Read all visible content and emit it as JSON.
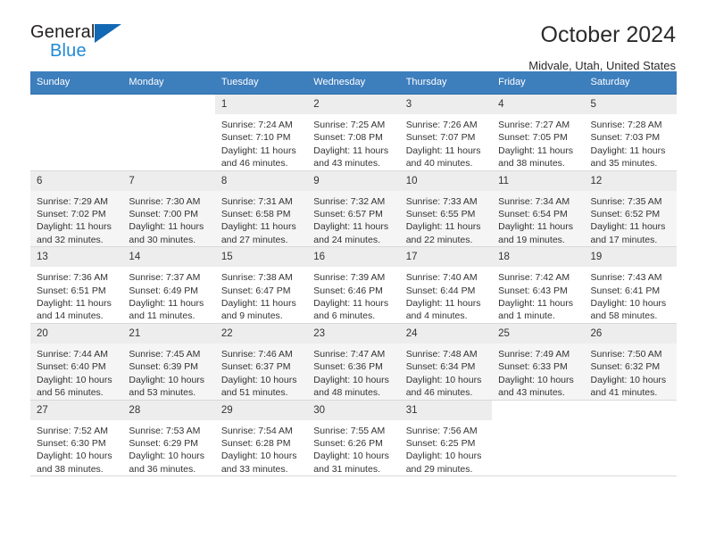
{
  "brand": {
    "name_top": "General",
    "name_bottom": "Blue",
    "triangle_icon": "triangle-icon",
    "color_top": "#231f20",
    "color_bottom": "#1e8ad6",
    "triangle_color": "#1268b3"
  },
  "header": {
    "title": "October 2024",
    "subtitle": "Midvale, Utah, United States"
  },
  "theme": {
    "header_row_bg": "#3d7ebd",
    "header_row_text": "#ffffff",
    "daynum_bg": "#ededed",
    "alt_row_bg": "#f5f5f5",
    "grid_line": "#2f6da8",
    "body_text": "#333333"
  },
  "weekday_headers": [
    "Sunday",
    "Monday",
    "Tuesday",
    "Wednesday",
    "Thursday",
    "Friday",
    "Saturday"
  ],
  "labels": {
    "sunrise_prefix": "Sunrise:",
    "sunset_prefix": "Sunset:",
    "daylight_prefix": "Daylight:"
  },
  "weeks": [
    {
      "alt": false,
      "days": [
        {
          "empty": true,
          "day": "",
          "sunrise": "",
          "sunset": "",
          "daylight_line1": "",
          "daylight_line2": ""
        },
        {
          "empty": true,
          "day": "",
          "sunrise": "",
          "sunset": "",
          "daylight_line1": "",
          "daylight_line2": ""
        },
        {
          "empty": false,
          "day": "1",
          "sunrise": "Sunrise: 7:24 AM",
          "sunset": "Sunset: 7:10 PM",
          "daylight_line1": "Daylight: 11 hours",
          "daylight_line2": "and 46 minutes."
        },
        {
          "empty": false,
          "day": "2",
          "sunrise": "Sunrise: 7:25 AM",
          "sunset": "Sunset: 7:08 PM",
          "daylight_line1": "Daylight: 11 hours",
          "daylight_line2": "and 43 minutes."
        },
        {
          "empty": false,
          "day": "3",
          "sunrise": "Sunrise: 7:26 AM",
          "sunset": "Sunset: 7:07 PM",
          "daylight_line1": "Daylight: 11 hours",
          "daylight_line2": "and 40 minutes."
        },
        {
          "empty": false,
          "day": "4",
          "sunrise": "Sunrise: 7:27 AM",
          "sunset": "Sunset: 7:05 PM",
          "daylight_line1": "Daylight: 11 hours",
          "daylight_line2": "and 38 minutes."
        },
        {
          "empty": false,
          "day": "5",
          "sunrise": "Sunrise: 7:28 AM",
          "sunset": "Sunset: 7:03 PM",
          "daylight_line1": "Daylight: 11 hours",
          "daylight_line2": "and 35 minutes."
        }
      ]
    },
    {
      "alt": true,
      "days": [
        {
          "empty": false,
          "day": "6",
          "sunrise": "Sunrise: 7:29 AM",
          "sunset": "Sunset: 7:02 PM",
          "daylight_line1": "Daylight: 11 hours",
          "daylight_line2": "and 32 minutes."
        },
        {
          "empty": false,
          "day": "7",
          "sunrise": "Sunrise: 7:30 AM",
          "sunset": "Sunset: 7:00 PM",
          "daylight_line1": "Daylight: 11 hours",
          "daylight_line2": "and 30 minutes."
        },
        {
          "empty": false,
          "day": "8",
          "sunrise": "Sunrise: 7:31 AM",
          "sunset": "Sunset: 6:58 PM",
          "daylight_line1": "Daylight: 11 hours",
          "daylight_line2": "and 27 minutes."
        },
        {
          "empty": false,
          "day": "9",
          "sunrise": "Sunrise: 7:32 AM",
          "sunset": "Sunset: 6:57 PM",
          "daylight_line1": "Daylight: 11 hours",
          "daylight_line2": "and 24 minutes."
        },
        {
          "empty": false,
          "day": "10",
          "sunrise": "Sunrise: 7:33 AM",
          "sunset": "Sunset: 6:55 PM",
          "daylight_line1": "Daylight: 11 hours",
          "daylight_line2": "and 22 minutes."
        },
        {
          "empty": false,
          "day": "11",
          "sunrise": "Sunrise: 7:34 AM",
          "sunset": "Sunset: 6:54 PM",
          "daylight_line1": "Daylight: 11 hours",
          "daylight_line2": "and 19 minutes."
        },
        {
          "empty": false,
          "day": "12",
          "sunrise": "Sunrise: 7:35 AM",
          "sunset": "Sunset: 6:52 PM",
          "daylight_line1": "Daylight: 11 hours",
          "daylight_line2": "and 17 minutes."
        }
      ]
    },
    {
      "alt": false,
      "days": [
        {
          "empty": false,
          "day": "13",
          "sunrise": "Sunrise: 7:36 AM",
          "sunset": "Sunset: 6:51 PM",
          "daylight_line1": "Daylight: 11 hours",
          "daylight_line2": "and 14 minutes."
        },
        {
          "empty": false,
          "day": "14",
          "sunrise": "Sunrise: 7:37 AM",
          "sunset": "Sunset: 6:49 PM",
          "daylight_line1": "Daylight: 11 hours",
          "daylight_line2": "and 11 minutes."
        },
        {
          "empty": false,
          "day": "15",
          "sunrise": "Sunrise: 7:38 AM",
          "sunset": "Sunset: 6:47 PM",
          "daylight_line1": "Daylight: 11 hours",
          "daylight_line2": "and 9 minutes."
        },
        {
          "empty": false,
          "day": "16",
          "sunrise": "Sunrise: 7:39 AM",
          "sunset": "Sunset: 6:46 PM",
          "daylight_line1": "Daylight: 11 hours",
          "daylight_line2": "and 6 minutes."
        },
        {
          "empty": false,
          "day": "17",
          "sunrise": "Sunrise: 7:40 AM",
          "sunset": "Sunset: 6:44 PM",
          "daylight_line1": "Daylight: 11 hours",
          "daylight_line2": "and 4 minutes."
        },
        {
          "empty": false,
          "day": "18",
          "sunrise": "Sunrise: 7:42 AM",
          "sunset": "Sunset: 6:43 PM",
          "daylight_line1": "Daylight: 11 hours",
          "daylight_line2": "and 1 minute."
        },
        {
          "empty": false,
          "day": "19",
          "sunrise": "Sunrise: 7:43 AM",
          "sunset": "Sunset: 6:41 PM",
          "daylight_line1": "Daylight: 10 hours",
          "daylight_line2": "and 58 minutes."
        }
      ]
    },
    {
      "alt": true,
      "days": [
        {
          "empty": false,
          "day": "20",
          "sunrise": "Sunrise: 7:44 AM",
          "sunset": "Sunset: 6:40 PM",
          "daylight_line1": "Daylight: 10 hours",
          "daylight_line2": "and 56 minutes."
        },
        {
          "empty": false,
          "day": "21",
          "sunrise": "Sunrise: 7:45 AM",
          "sunset": "Sunset: 6:39 PM",
          "daylight_line1": "Daylight: 10 hours",
          "daylight_line2": "and 53 minutes."
        },
        {
          "empty": false,
          "day": "22",
          "sunrise": "Sunrise: 7:46 AM",
          "sunset": "Sunset: 6:37 PM",
          "daylight_line1": "Daylight: 10 hours",
          "daylight_line2": "and 51 minutes."
        },
        {
          "empty": false,
          "day": "23",
          "sunrise": "Sunrise: 7:47 AM",
          "sunset": "Sunset: 6:36 PM",
          "daylight_line1": "Daylight: 10 hours",
          "daylight_line2": "and 48 minutes."
        },
        {
          "empty": false,
          "day": "24",
          "sunrise": "Sunrise: 7:48 AM",
          "sunset": "Sunset: 6:34 PM",
          "daylight_line1": "Daylight: 10 hours",
          "daylight_line2": "and 46 minutes."
        },
        {
          "empty": false,
          "day": "25",
          "sunrise": "Sunrise: 7:49 AM",
          "sunset": "Sunset: 6:33 PM",
          "daylight_line1": "Daylight: 10 hours",
          "daylight_line2": "and 43 minutes."
        },
        {
          "empty": false,
          "day": "26",
          "sunrise": "Sunrise: 7:50 AM",
          "sunset": "Sunset: 6:32 PM",
          "daylight_line1": "Daylight: 10 hours",
          "daylight_line2": "and 41 minutes."
        }
      ]
    },
    {
      "alt": false,
      "days": [
        {
          "empty": false,
          "day": "27",
          "sunrise": "Sunrise: 7:52 AM",
          "sunset": "Sunset: 6:30 PM",
          "daylight_line1": "Daylight: 10 hours",
          "daylight_line2": "and 38 minutes."
        },
        {
          "empty": false,
          "day": "28",
          "sunrise": "Sunrise: 7:53 AM",
          "sunset": "Sunset: 6:29 PM",
          "daylight_line1": "Daylight: 10 hours",
          "daylight_line2": "and 36 minutes."
        },
        {
          "empty": false,
          "day": "29",
          "sunrise": "Sunrise: 7:54 AM",
          "sunset": "Sunset: 6:28 PM",
          "daylight_line1": "Daylight: 10 hours",
          "daylight_line2": "and 33 minutes."
        },
        {
          "empty": false,
          "day": "30",
          "sunrise": "Sunrise: 7:55 AM",
          "sunset": "Sunset: 6:26 PM",
          "daylight_line1": "Daylight: 10 hours",
          "daylight_line2": "and 31 minutes."
        },
        {
          "empty": false,
          "day": "31",
          "sunrise": "Sunrise: 7:56 AM",
          "sunset": "Sunset: 6:25 PM",
          "daylight_line1": "Daylight: 10 hours",
          "daylight_line2": "and 29 minutes."
        },
        {
          "empty": true,
          "day": "",
          "sunrise": "",
          "sunset": "",
          "daylight_line1": "",
          "daylight_line2": ""
        },
        {
          "empty": true,
          "day": "",
          "sunrise": "",
          "sunset": "",
          "daylight_line1": "",
          "daylight_line2": ""
        }
      ]
    }
  ]
}
